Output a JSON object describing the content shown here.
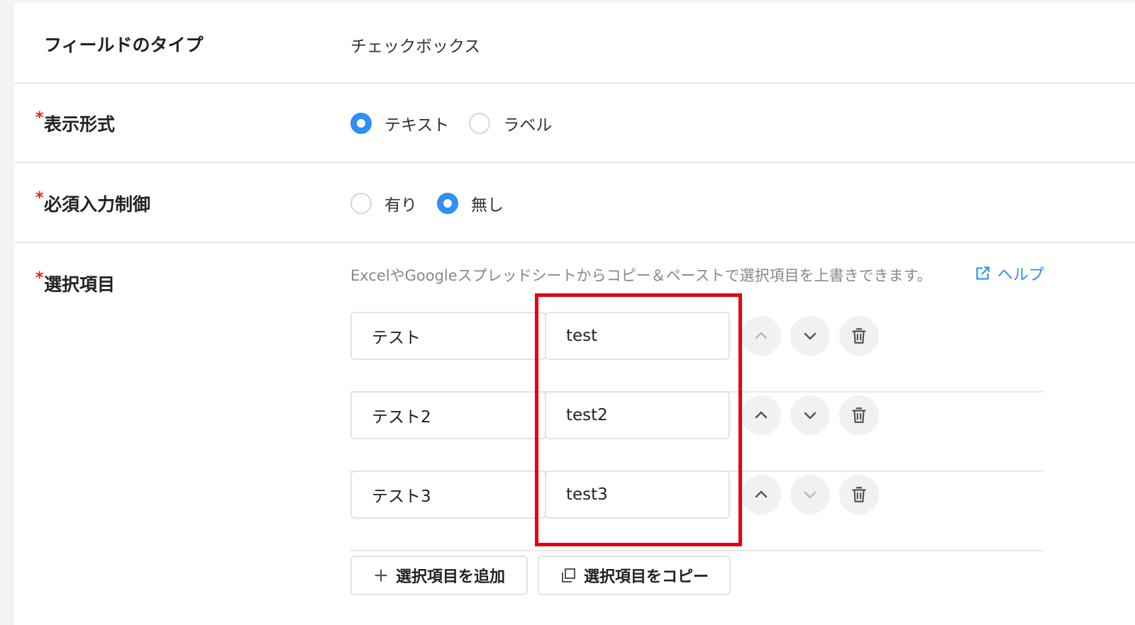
{
  "field_type": {
    "label": "フィールドのタイプ",
    "value": "チェックボックス"
  },
  "display_format": {
    "required_mark": "*",
    "label": "表示形式",
    "options": [
      {
        "label": "テキスト",
        "checked": true
      },
      {
        "label": "ラベル",
        "checked": false
      }
    ]
  },
  "required_control": {
    "required_mark": "*",
    "label": "必須入力制御",
    "options": [
      {
        "label": "有り",
        "checked": false
      },
      {
        "label": "無し",
        "checked": true
      }
    ]
  },
  "choices": {
    "required_mark": "*",
    "label": "選択項目",
    "hint": "ExcelやGoogleスプレッドシートからコピー＆ペーストで選択項目を上書きできます。",
    "help_label": "ヘルプ",
    "items": [
      {
        "label": "テスト",
        "value": "test"
      },
      {
        "label": "テスト2",
        "value": "test2"
      },
      {
        "label": "テスト3",
        "value": "test3"
      }
    ],
    "add_button": "選択項目を追加",
    "copy_button": "選択項目をコピー"
  },
  "colors": {
    "accent": "#2f8ff4",
    "required": "#e02424",
    "highlight": "#e60012"
  },
  "icons": [
    "chevron-up-icon",
    "chevron-down-icon",
    "trash-icon",
    "external-link-icon",
    "plus-icon",
    "copy-icon"
  ]
}
